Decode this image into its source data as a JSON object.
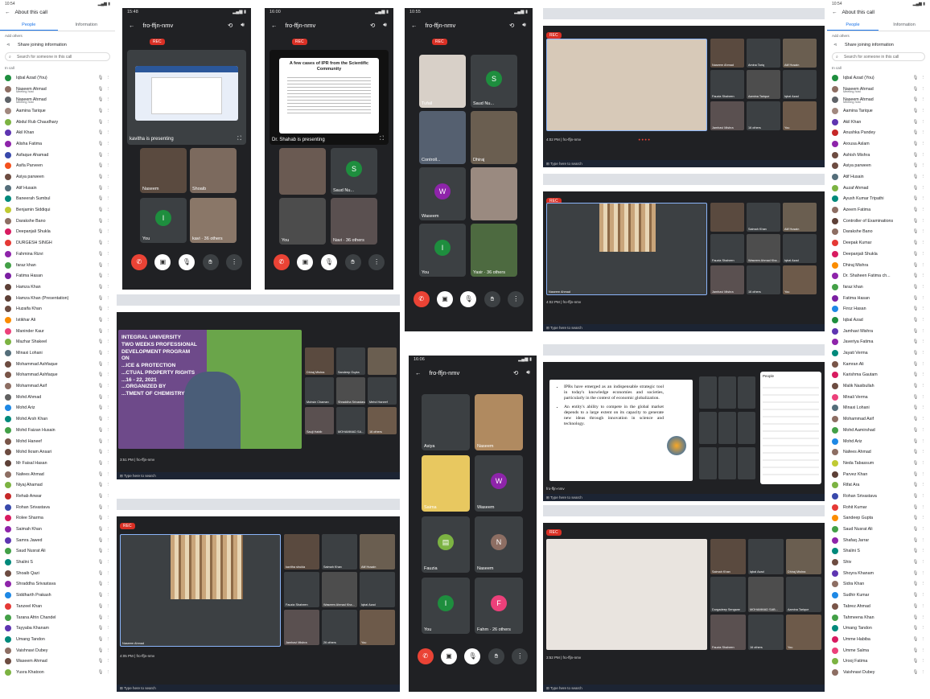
{
  "left_panel": {
    "status_time": "10:54",
    "title": "About this call",
    "tabs": [
      "People",
      "Information"
    ],
    "add_others": "Add others",
    "share_label": "Share joining information",
    "search_placeholder": "Search for someone in this call",
    "in_call": "In call",
    "participants": [
      {
        "name": "Iqbal Azad (You)",
        "color": "#1e8e3e"
      },
      {
        "name": "Naseem Ahmad",
        "sub": "Meeting host",
        "color": "#8d6e63"
      },
      {
        "name": "Naseem Ahmad",
        "sub": "Meeting host",
        "color": "#5f6368"
      },
      {
        "name": "Aamina Tarique",
        "color": "#a1887f"
      },
      {
        "name": "Abdul Rub Chaudhary",
        "color": "#7cb342"
      },
      {
        "name": "Akil Khan",
        "color": "#5e35b1"
      },
      {
        "name": "Alisha Fatima",
        "color": "#8e24aa"
      },
      {
        "name": "Asfaque Ahamad",
        "color": "#3949ab"
      },
      {
        "name": "Asifa Parveen",
        "color": "#f4511e"
      },
      {
        "name": "Asiya parween",
        "color": "#6d4c41"
      },
      {
        "name": "Atif Husain",
        "color": "#546e7a"
      },
      {
        "name": "Baneerah Sumbul",
        "color": "#00897b"
      },
      {
        "name": "Benjamin Siddiqui",
        "color": "#c0ca33"
      },
      {
        "name": "Darakshe Bano",
        "color": "#8d6e63"
      },
      {
        "name": "Deepanjali Shukla",
        "color": "#d81b60"
      },
      {
        "name": "DURGESH SINGH",
        "color": "#e53935"
      },
      {
        "name": "Fahmina Rizvi",
        "color": "#8e24aa"
      },
      {
        "name": "faraz khan",
        "color": "#43a047"
      },
      {
        "name": "Fatima Hasan",
        "color": "#7b1fa2"
      },
      {
        "name": "Hamza Khan",
        "color": "#5d4037"
      },
      {
        "name": "Hamza Khan (Presentation)",
        "color": "#5d4037"
      },
      {
        "name": "Huzaifa Khan",
        "color": "#6d4c41"
      },
      {
        "name": "Istikhar Ali",
        "color": "#fb8c00"
      },
      {
        "name": "Maninder Kaur",
        "color": "#ec407a"
      },
      {
        "name": "Mazhar Shakeel",
        "color": "#7cb342"
      },
      {
        "name": "Minaxi Lohani",
        "color": "#546e7a"
      },
      {
        "name": "Mohammad Ashfaque",
        "color": "#6d4c41"
      },
      {
        "name": "Mohammad Ashfaque",
        "color": "#795548"
      },
      {
        "name": "Mohammad Asif",
        "color": "#8d6e63"
      },
      {
        "name": "Mohd Ahmad",
        "color": "#616161"
      },
      {
        "name": "Mohd Ariz",
        "color": "#1e88e5"
      },
      {
        "name": "Mohd Arsh Khan",
        "color": "#00897b"
      },
      {
        "name": "Mohd Faizan Husain",
        "color": "#43a047"
      },
      {
        "name": "Mohd Haneef",
        "color": "#795548"
      },
      {
        "name": "Mohd Ikram Ansari",
        "color": "#6d4c41"
      },
      {
        "name": "Mr Faisal Hasan",
        "color": "#5d4037"
      },
      {
        "name": "Nafees Ahmad",
        "color": "#8d6e63"
      },
      {
        "name": "Niyaj Ahamad",
        "color": "#7cb342"
      },
      {
        "name": "Rehab Anwar",
        "color": "#c62828"
      },
      {
        "name": "Rohan Srivastava",
        "color": "#3949ab"
      },
      {
        "name": "Rolee Sharma",
        "color": "#d81b60"
      },
      {
        "name": "Saimah Khan",
        "color": "#8e24aa"
      },
      {
        "name": "Samra Jawed",
        "color": "#5e35b1"
      },
      {
        "name": "Saud Nusrat Ali",
        "color": "#43a047"
      },
      {
        "name": "Shalini S",
        "color": "#00897b"
      },
      {
        "name": "Shoaib Qazi",
        "color": "#6d4c41"
      },
      {
        "name": "Shraddha Srivastava",
        "color": "#8e24aa"
      },
      {
        "name": "Siddharth Prakash",
        "color": "#1e88e5"
      },
      {
        "name": "Tanzeel Khan",
        "color": "#e53935"
      },
      {
        "name": "Tarana Afrin Chandel",
        "color": "#43a047"
      },
      {
        "name": "Tayyaba Khanam",
        "color": "#5e35b1"
      },
      {
        "name": "Umang Tandon",
        "color": "#00897b"
      },
      {
        "name": "Vaishnavi Dubey",
        "color": "#8d6e63"
      },
      {
        "name": "Waseem Ahmad",
        "color": "#6d4c41"
      },
      {
        "name": "Yusra Khatoon",
        "color": "#7cb342"
      }
    ]
  },
  "right_panel": {
    "status_time": "10:54",
    "title": "About this call",
    "tabs": [
      "People",
      "Information"
    ],
    "add_others": "Add others",
    "share_label": "Share joining information",
    "search_placeholder": "Search for someone in this call",
    "in_call": "In call",
    "participants": [
      {
        "name": "Iqbal Azad (You)",
        "color": "#1e8e3e"
      },
      {
        "name": "Naseem Ahmad",
        "sub": "Meeting host",
        "color": "#8d6e63"
      },
      {
        "name": "Naseem Ahmad",
        "sub": "Meeting host",
        "color": "#5f6368"
      },
      {
        "name": "Aamina Tarique",
        "color": "#a1887f"
      },
      {
        "name": "Akil Khan",
        "color": "#5e35b1"
      },
      {
        "name": "Anushka Pandey",
        "color": "#c62828"
      },
      {
        "name": "Arousa Aslam",
        "color": "#8e24aa"
      },
      {
        "name": "Ashish Mishra",
        "color": "#6d4c41"
      },
      {
        "name": "Asiya parween",
        "color": "#6d4c41"
      },
      {
        "name": "Atif Husain",
        "color": "#546e7a"
      },
      {
        "name": "Auzaf Ahmad",
        "color": "#7cb342"
      },
      {
        "name": "Ayush Kumar Tripathi",
        "color": "#00897b"
      },
      {
        "name": "Azeem Fatima",
        "color": "#8d6e63"
      },
      {
        "name": "Controller of Examinations",
        "color": "#5d4037"
      },
      {
        "name": "Darakshe Bano",
        "color": "#8d6e63"
      },
      {
        "name": "Deepak Kumar",
        "color": "#e53935"
      },
      {
        "name": "Deepanjali Shukla",
        "color": "#d81b60"
      },
      {
        "name": "Dhiraj Mishra",
        "color": "#fb8c00"
      },
      {
        "name": "Dr. Shaheen Fatima ch...",
        "color": "#8e24aa"
      },
      {
        "name": "faraz khan",
        "color": "#43a047"
      },
      {
        "name": "Fatima Hasan",
        "color": "#7b1fa2"
      },
      {
        "name": "Firoz Hasan",
        "color": "#1e88e5"
      },
      {
        "name": "Iqbal Azad",
        "color": "#1e8e3e"
      },
      {
        "name": "Jamhavi Mishra",
        "color": "#5e35b1"
      },
      {
        "name": "Javeriya Fatima",
        "color": "#8e24aa"
      },
      {
        "name": "Jayati Verma",
        "color": "#00897b"
      },
      {
        "name": "Kamran Ali",
        "color": "#795548"
      },
      {
        "name": "Karishma Gautam",
        "color": "#d81b60"
      },
      {
        "name": "Malik Nasibullah",
        "color": "#6d4c41"
      },
      {
        "name": "Minali Verma",
        "color": "#ec407a"
      },
      {
        "name": "Minaxi Lohani",
        "color": "#546e7a"
      },
      {
        "name": "Mohammad Asif",
        "color": "#8d6e63"
      },
      {
        "name": "Mohd Aamirshad",
        "color": "#43a047"
      },
      {
        "name": "Mohd Ariz",
        "color": "#1e88e5"
      },
      {
        "name": "Nafees Ahmad",
        "color": "#8d6e63"
      },
      {
        "name": "Neda Tabassum",
        "color": "#c0ca33"
      },
      {
        "name": "Parvez Khan",
        "color": "#5d4037"
      },
      {
        "name": "Rifat Ara",
        "color": "#7cb342"
      },
      {
        "name": "Rohan Srivastava",
        "color": "#3949ab"
      },
      {
        "name": "Rohit Kumar",
        "color": "#e53935"
      },
      {
        "name": "Sandeep Gupta",
        "color": "#fb8c00"
      },
      {
        "name": "Saud Nusrat Ali",
        "color": "#43a047"
      },
      {
        "name": "Shafaq Jarrar",
        "color": "#8e24aa"
      },
      {
        "name": "Shalini S",
        "color": "#00897b"
      },
      {
        "name": "Shiv",
        "color": "#6d4c41"
      },
      {
        "name": "Shoyra Khanam",
        "color": "#5e35b1"
      },
      {
        "name": "Sidra Khan",
        "color": "#8d6e63"
      },
      {
        "name": "Sudhir Kumar",
        "color": "#1e88e5"
      },
      {
        "name": "Tabrez Ahmad",
        "color": "#795548"
      },
      {
        "name": "Tahmeena Khan",
        "color": "#43a047"
      },
      {
        "name": "Umang Tandon",
        "color": "#00897b"
      },
      {
        "name": "Umme Habiba",
        "color": "#d81b60"
      },
      {
        "name": "Umme Salma",
        "color": "#ec407a"
      },
      {
        "name": "Urooj Fatima",
        "color": "#7cb342"
      },
      {
        "name": "Vaishnavi Dubey",
        "color": "#8d6e63"
      }
    ]
  },
  "phone1": {
    "time": "15:48",
    "meeting_code": "fro-ffjn-nmv",
    "rec": "REC",
    "presenting_label": "kavitha is presenting",
    "tiles": [
      "Naseem",
      "Shoaib",
      "You",
      "kavi"
    ],
    "others": "36 others"
  },
  "phone2": {
    "time": "16:00",
    "meeting_code": "fro-ffjn-nmv",
    "rec": "REC",
    "slide_title": "A few cases of IPR from the Scientific Community",
    "presenting_label": "Dr. Shahab is presenting",
    "tiles": [
      "",
      "Saud Nu...",
      "You",
      "Navi"
    ],
    "others": "36 others"
  },
  "phone3": {
    "time": "10:55",
    "meeting_code": "fro-ffjn-nmv",
    "rec": "REC",
    "tiles": [
      "Tufail",
      "Saud Nu...",
      "Controll...",
      "Dhiraj",
      "Waseem",
      "",
      "You",
      "Yasir"
    ],
    "others": "36 others"
  },
  "phone4": {
    "time": "16:06",
    "meeting_code": "fro-ffjn-nmv",
    "tiles": [
      "Asiya",
      "Naseem",
      "Saima",
      "Waseem",
      "Fauzia",
      "Naseem",
      "You",
      "Fahm"
    ],
    "others": "26 others"
  },
  "desk1": {
    "time": "4:02 PM",
    "code": "fro-ffjn-nmv",
    "names": [
      "Naseem Ahmad",
      "Amina Tariq",
      "Atif Husain",
      "Fauzia Shaheen",
      "Aamina Tarique",
      "Iqbal Azad",
      "Jamhavi Mishra",
      "16 others",
      "You"
    ]
  },
  "desk2": {
    "time": "4:02 PM",
    "code": "fro-ffjn-nmv",
    "presenter": "Naseem Ahmad",
    "names": [
      "",
      "Saimah Khan",
      "Atif Husain",
      "Fauzia Shaheen",
      "Waseem Ahmad Kha...",
      "Iqbal Azad",
      "Jamhavi Mishra",
      "16 others",
      "You"
    ]
  },
  "desk3": {
    "time": "3:51 PM",
    "code": "fro-ffjn-nmv",
    "banner_lines": [
      "INTEGRAL UNIVERSITY",
      "TWO WEEKS PROFESSIONAL",
      "DEVELOPMENT PROGRAM",
      "ON",
      "...ICE & PROTECTION",
      "...CTUAL PROPERTY RIGHTS",
      "...16 - 22, 2021",
      "...ORGANIZED BY",
      "...TMENT OF CHEMISTRY"
    ],
    "names": [
      "Dhiraj Mishra",
      "Sandeep Gupta",
      "",
      "Mohsin Chaman",
      "Shraddha Srivastava",
      "Mehd Haneef",
      "Sauji Habib",
      "MOHAMMAD SA...",
      "16 others"
    ]
  },
  "desk4": {
    "time": "4:05 PM",
    "code": "fro-ffjn-nmv",
    "presenter": "Naseem Ahmad",
    "names": [
      "kavitha shukla",
      "Saimah Khan",
      "Atif Husain",
      "Fauzia Shaheen",
      "Waseem Ahmad Kha...",
      "Iqbal Azad",
      "Jamhavi Mishra",
      "26 others",
      "You"
    ]
  },
  "desk5": {
    "code": "fro-ffjn-nmv",
    "presenting": "Your Meet is presenting",
    "bullets": [
      "IPRs have emerged as an indispensable strategic tool in today's knowledge economies and societies, particularly in the context of economic globalization.",
      "An entity's ability to compete in the global market depends to a large extent on its capacity to generate new ideas through innovation in science and technology."
    ],
    "people_header": "People"
  },
  "desk6": {
    "time": "3:52 PM",
    "code": "fro-ffjn-nmv",
    "names": [
      "Saimah Khan",
      "Iqbal Azad",
      "Dhiraj Mishra",
      "Durgadeep Sengwar",
      "MOHAMMAD SAB...",
      "Aamina Tarique",
      "Fauzia Shaheen",
      "16 others",
      "You"
    ]
  }
}
